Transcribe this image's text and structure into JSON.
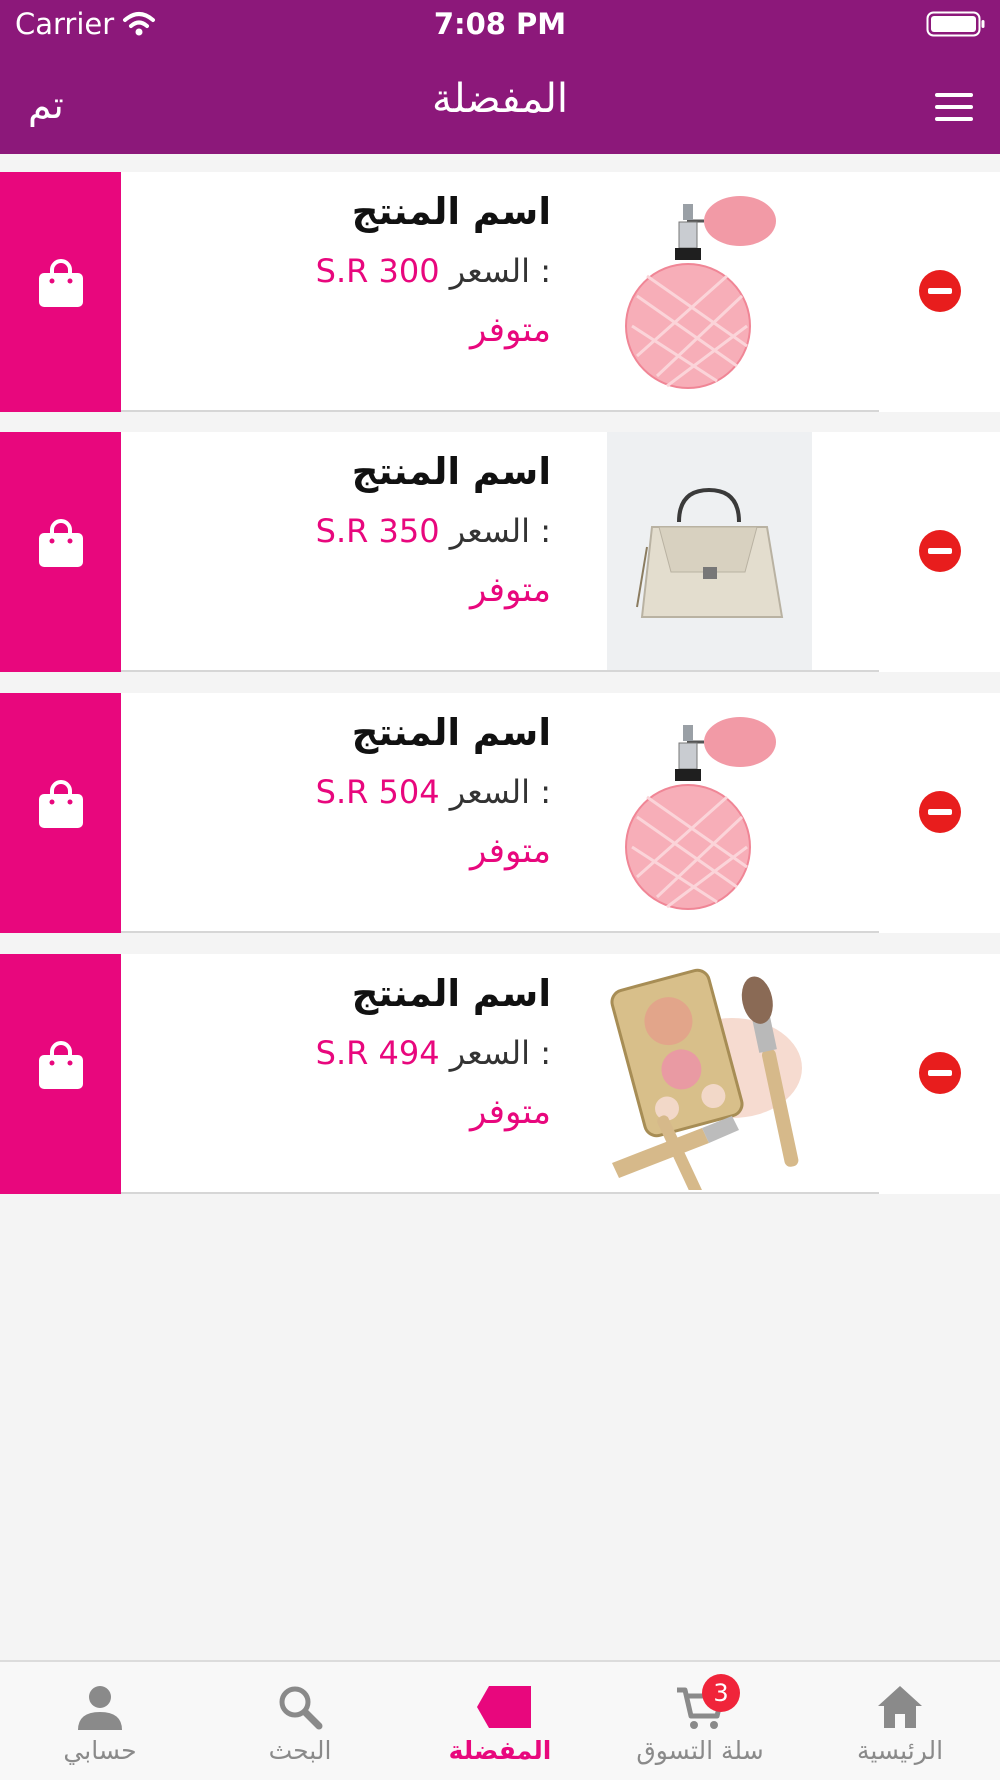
{
  "status_bar": {
    "carrier": "Carrier",
    "time": "7:08 PM"
  },
  "nav": {
    "done_label": "تم",
    "title": "المفضلة",
    "menu_icon": "hamburger-icon"
  },
  "colors": {
    "nav_bg": "#8c187a",
    "accent": "#e8077d",
    "remove": "#e81d1d",
    "badge": "#f0243a"
  },
  "favorites": [
    {
      "name": "اسم المنتج",
      "price_label": "السعر :",
      "price_value": "S.R 300",
      "availability": "متوفر",
      "image": "perfume-bottle"
    },
    {
      "name": "اسم المنتج",
      "price_label": "السعر :",
      "price_value": "S.R 350",
      "availability": "متوفر",
      "image": "handbag"
    },
    {
      "name": "اسم المنتج",
      "price_label": "السعر :",
      "price_value": "S.R 504",
      "availability": "متوفر",
      "image": "perfume-bottle"
    },
    {
      "name": "اسم المنتج",
      "price_label": "السعر :",
      "price_value": "S.R 494",
      "availability": "متوفر",
      "image": "makeup-palette"
    }
  ],
  "tabs": [
    {
      "label": "حسابي",
      "icon": "person-icon",
      "active": false
    },
    {
      "label": "البحث",
      "icon": "search-icon",
      "active": false
    },
    {
      "label": "المفضلة",
      "icon": "tag-icon",
      "active": true
    },
    {
      "label": "سلة التسوق",
      "icon": "cart-icon",
      "active": false,
      "badge": "3"
    },
    {
      "label": "الرئيسية",
      "icon": "home-icon",
      "active": false
    }
  ]
}
